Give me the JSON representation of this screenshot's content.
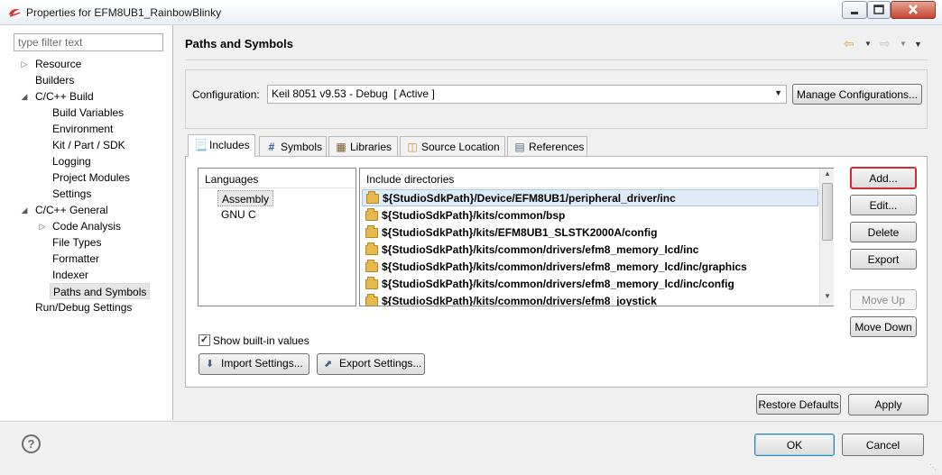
{
  "window": {
    "title": "Properties for EFM8UB1_RainbowBlinky",
    "icon": "simplicity-studio-icon"
  },
  "sidebar": {
    "filter_placeholder": "type filter text",
    "items": [
      {
        "label": "Resource"
      },
      {
        "label": "Builders"
      },
      {
        "label": "C/C++ Build"
      },
      {
        "label": "Build Variables"
      },
      {
        "label": "Environment"
      },
      {
        "label": "Kit / Part / SDK"
      },
      {
        "label": "Logging"
      },
      {
        "label": "Project Modules"
      },
      {
        "label": "Settings"
      },
      {
        "label": "C/C++ General"
      },
      {
        "label": "Code Analysis"
      },
      {
        "label": "File Types"
      },
      {
        "label": "Formatter"
      },
      {
        "label": "Indexer"
      },
      {
        "label": "Paths and Symbols"
      },
      {
        "label": "Run/Debug Settings"
      }
    ]
  },
  "header": {
    "title": "Paths and Symbols"
  },
  "configuration": {
    "label": "Configuration:",
    "selected": "Keil 8051 v9.53 - Debug  [ Active ]",
    "manage_label": "Manage Configurations..."
  },
  "tabs": [
    {
      "label": "Includes",
      "icon": "includes-icon",
      "active": true
    },
    {
      "label": "Symbols",
      "icon": "hash-icon"
    },
    {
      "label": "Libraries",
      "icon": "library-icon"
    },
    {
      "label": "Source Location",
      "icon": "source-folder-icon"
    },
    {
      "label": "References",
      "icon": "references-icon"
    }
  ],
  "languages": {
    "header": "Languages",
    "items": [
      "Assembly",
      "GNU C"
    ],
    "selected": "Assembly"
  },
  "include_dirs": {
    "header": "Include directories",
    "items": [
      "${StudioSdkPath}/Device/EFM8UB1/peripheral_driver/inc",
      "${StudioSdkPath}/kits/common/bsp",
      "${StudioSdkPath}/kits/EFM8UB1_SLSTK2000A/config",
      "${StudioSdkPath}/kits/common/drivers/efm8_memory_lcd/inc",
      "${StudioSdkPath}/kits/common/drivers/efm8_memory_lcd/inc/graphics",
      "${StudioSdkPath}/kits/common/drivers/efm8_memory_lcd/inc/config",
      "${StudioSdkPath}/kits/common/drivers/efm8_joystick"
    ]
  },
  "side_buttons": {
    "add": "Add...",
    "edit": "Edit...",
    "delete": "Delete",
    "export": "Export",
    "move_up": "Move Up",
    "move_down": "Move Down"
  },
  "options": {
    "show_builtin_label": "Show built-in values",
    "show_builtin_checked": true,
    "import_label": "Import Settings...",
    "export_label": "Export Settings..."
  },
  "footer": {
    "restore_label": "Restore Defaults",
    "apply_label": "Apply",
    "ok_label": "OK",
    "cancel_label": "Cancel"
  },
  "colors": {
    "highlight_border": "#d12b2b",
    "selection_bg": "#dfebf7"
  }
}
